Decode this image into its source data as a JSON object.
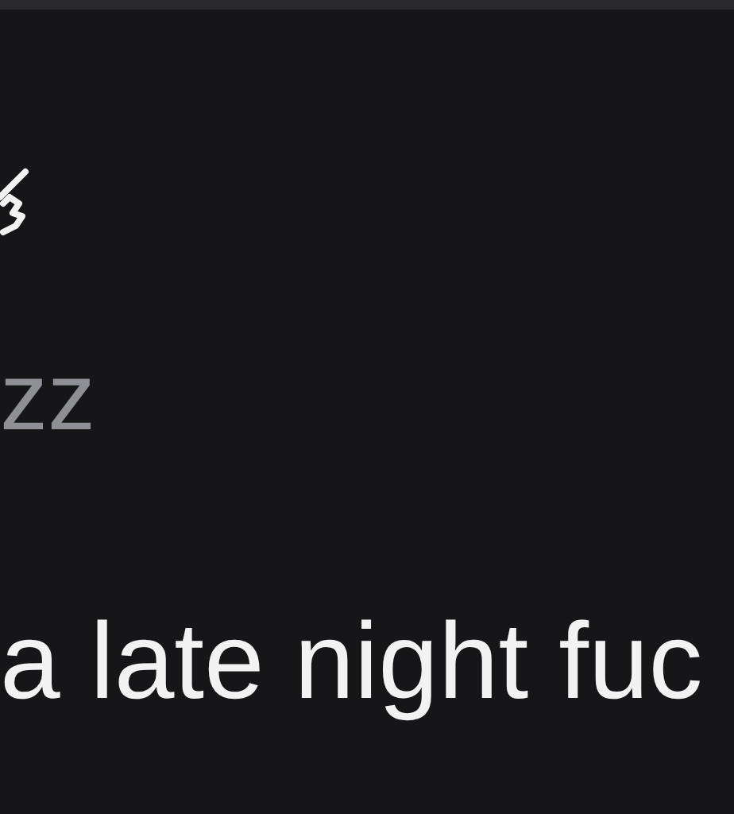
{
  "status_text": "zz",
  "post_text": "a late night fuc"
}
